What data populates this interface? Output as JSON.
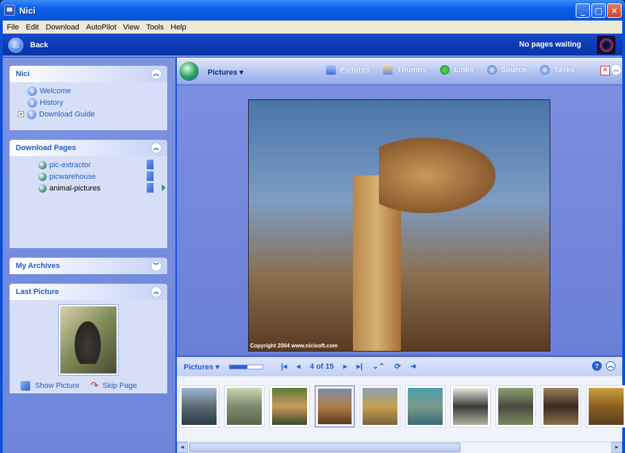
{
  "window": {
    "title": "Nici",
    "minimize": "_",
    "maximize": "□",
    "close": "✕"
  },
  "menu": [
    "File",
    "Edit",
    "Download",
    "AutoPilot",
    "View",
    "Tools",
    "Help"
  ],
  "toolbar": {
    "back_label": "Back",
    "status": "No pages waiting"
  },
  "sidebar": {
    "nici": {
      "title": "Nici",
      "items": [
        "Welcome",
        "History",
        "Download Guide"
      ]
    },
    "download_pages": {
      "title": "Download Pages",
      "items": [
        "pic-extractor",
        "picwarehouse",
        "animal-pictures"
      ]
    },
    "my_archives": {
      "title": "My Archives"
    },
    "last_picture": {
      "title": "Last Picture",
      "show_label": "Show Picture",
      "skip_label": "Skip Page"
    }
  },
  "main": {
    "view_title": "Pictures",
    "tabs": [
      {
        "label": "Pictures",
        "icon": "monitor-icon"
      },
      {
        "label": "Thumbs",
        "icon": "thumbs-icon"
      },
      {
        "label": "Links",
        "icon": "links-icon"
      },
      {
        "label": "Source",
        "icon": "source-icon"
      },
      {
        "label": "Tasks",
        "icon": "info-icon"
      }
    ],
    "photo_copyright": "Copyright 2004 www.nicisoft.com"
  },
  "strip": {
    "label": "Pictures",
    "counter": "4 of 15",
    "progress_fraction": 0.55,
    "selected_index": 3,
    "thumbnails": [
      "elephants-reflection",
      "elephant",
      "giraffe",
      "giraffe-selected",
      "lion",
      "hippo",
      "zebra",
      "rhino",
      "chimp",
      "lion-2"
    ]
  },
  "colors": {
    "accent": "#215dc6",
    "titlebar": "#0a5fe8",
    "panel": "#d6dff7"
  }
}
